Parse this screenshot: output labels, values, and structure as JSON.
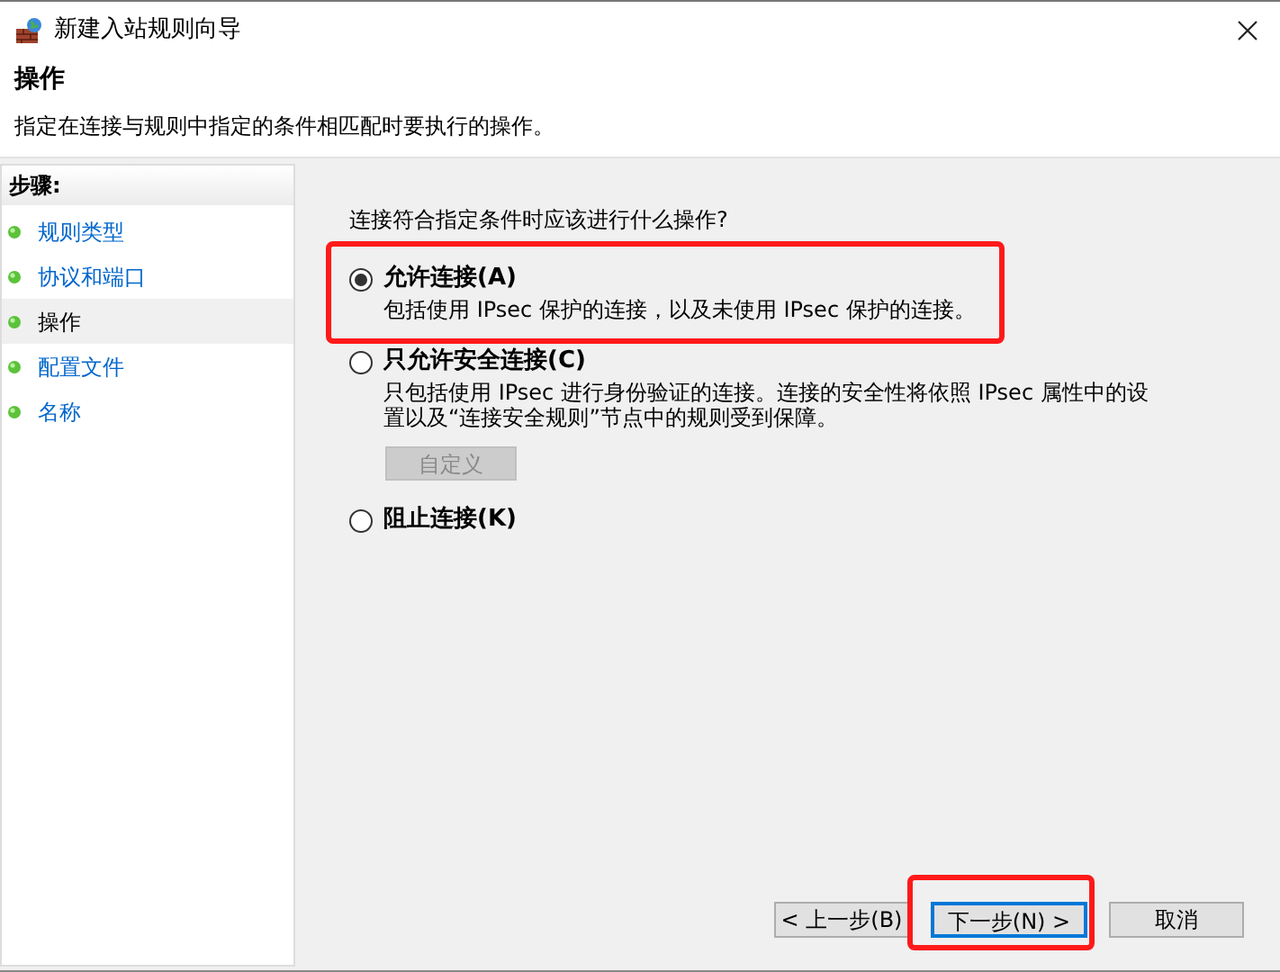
{
  "window": {
    "title": "新建入站规则向导"
  },
  "header": {
    "title": "操作",
    "subtitle": "指定在连接与规则中指定的条件相匹配时要执行的操作。"
  },
  "steps": {
    "heading": "步骤:",
    "items": [
      {
        "label": "规则类型",
        "selected": false
      },
      {
        "label": "协议和端口",
        "selected": false
      },
      {
        "label": "操作",
        "selected": true
      },
      {
        "label": "配置文件",
        "selected": false
      },
      {
        "label": "名称",
        "selected": false
      }
    ]
  },
  "question": "连接符合指定条件时应该进行什么操作?",
  "options": [
    {
      "label": "允许连接(A)",
      "selected": true,
      "description": "包括使用 IPsec 保护的连接，以及未使用 IPsec 保护的连接。"
    },
    {
      "label": "只允许安全连接(C)",
      "selected": false,
      "description": "只包括使用 IPsec 进行身份验证的连接。连接的安全性将依照 IPsec 属性中的设置以及“连接安全规则”节点中的规则受到保障。",
      "button": {
        "label": "自定义",
        "disabled": true
      }
    },
    {
      "label": "阻止连接(K)",
      "selected": false
    }
  ],
  "buttons": [
    {
      "label": "< 上一步(B)",
      "focused": false
    },
    {
      "label": "下一步(N) >",
      "focused": true
    },
    {
      "label": "取消",
      "focused": false
    }
  ]
}
